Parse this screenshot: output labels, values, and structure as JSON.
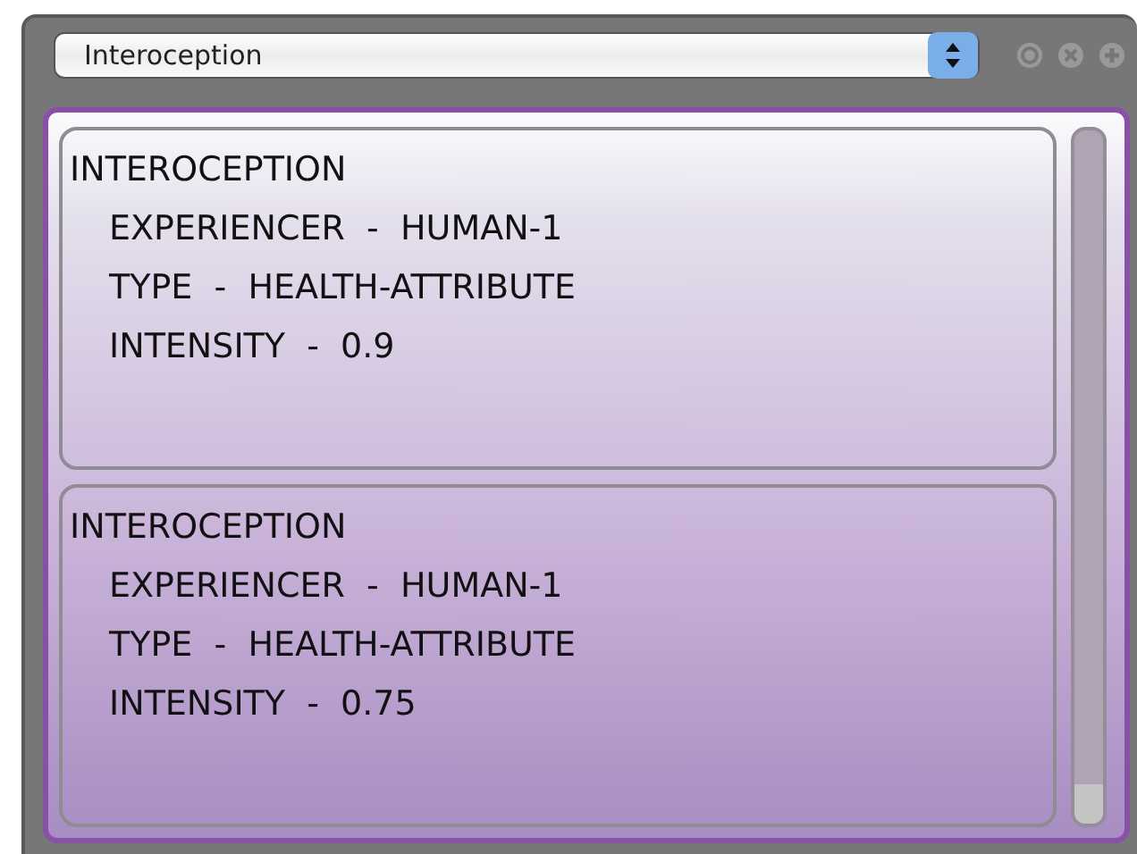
{
  "selector": {
    "value": "Interoception"
  },
  "cards": [
    {
      "title": "INTEROCEPTION",
      "lines": [
        "EXPERIENCER  -  HUMAN-1",
        "TYPE  -  HEALTH-ATTRIBUTE",
        "INTENSITY  -  0.9"
      ]
    },
    {
      "title": "INTEROCEPTION",
      "lines": [
        "EXPERIENCER  -  HUMAN-1",
        "TYPE  -  HEALTH-ATTRIBUTE",
        "INTENSITY  -  0.75"
      ]
    }
  ]
}
